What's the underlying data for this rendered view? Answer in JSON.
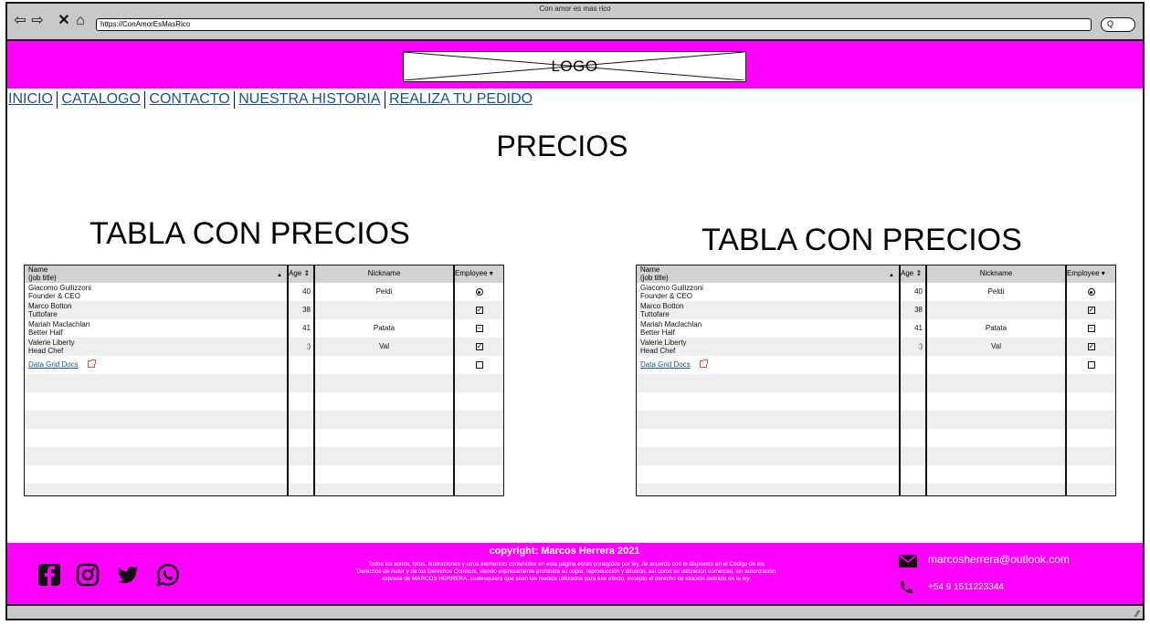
{
  "browser": {
    "window_title": "Con amor es mas rico",
    "url": "https://ConAmorEsMasRico",
    "search_glyph": "Q"
  },
  "header": {
    "logo_text": "LOGO"
  },
  "nav": {
    "items": [
      {
        "label": "INICIO"
      },
      {
        "label": "CATALOGO"
      },
      {
        "label": "CONTACTO"
      },
      {
        "label": "NUESTRA HISTORIA"
      },
      {
        "label": "REALIZA TU PEDIDO"
      }
    ]
  },
  "main": {
    "title": "PRECIOS",
    "tables": [
      {
        "title": "TABLA CON PRECIOS",
        "columns": {
          "name": "Name",
          "name_sub": "(job title)",
          "age": "Age",
          "nickname": "Nickname",
          "employee": "Employee"
        },
        "rows": [
          {
            "name": "Giacomo Guilizzoni",
            "title": "Founder & CEO",
            "age": "40",
            "nickname": "Peldi",
            "employee": "radio"
          },
          {
            "name": "Marco Botton",
            "title": "Tuttofare",
            "age": "38",
            "nickname": "",
            "employee": "checked"
          },
          {
            "name": "Mariah Maclachlan",
            "title": "Better Half",
            "age": "41",
            "nickname": "Patata",
            "employee": "mixed"
          },
          {
            "name": "Valerie Liberty",
            "title": "Head Chef",
            "age": ":)",
            "nickname": "Val",
            "employee": "checked"
          }
        ],
        "link": "Data Grid Docs",
        "link_employee": "unchecked"
      },
      {
        "title": "TABLA CON PRECIOS",
        "columns": {
          "name": "Name",
          "name_sub": "(job title)",
          "age": "Age",
          "nickname": "Nickname",
          "employee": "Employee"
        },
        "rows": [
          {
            "name": "Giacomo Guilizzoni",
            "title": "Founder & CEO",
            "age": "40",
            "nickname": "Peldi",
            "employee": "radio"
          },
          {
            "name": "Marco Botton",
            "title": "Tuttofare",
            "age": "38",
            "nickname": "",
            "employee": "checked"
          },
          {
            "name": "Mariah Maclachlan",
            "title": "Better Half",
            "age": "41",
            "nickname": "Patata",
            "employee": "mixed"
          },
          {
            "name": "Valerie Liberty",
            "title": "Head Chef",
            "age": ":)",
            "nickname": "Val",
            "employee": "checked"
          }
        ],
        "link": "Data Grid Docs",
        "link_employee": "unchecked"
      }
    ]
  },
  "footer": {
    "copyright": "copyright: Marcos Herrera 2021",
    "legal": "Todos los textos, fotos, ilustraciones y otros elementos contenidos en esta página están protegidos por ley, de acuerdo con lo dispuesto en el Código de los Derechos de Autor y de los Derechos Conexos, siendo expresamente prohibida su copia, reproducción y difusión, así como su utilización comercial, sin autorización expresa de MARCOS HERRERA, cualesquiera que sean los medios utilizados para ese efecto, excepto el derecho de citación definido en la ley.",
    "email": "marcosherrera@outlook.com",
    "phone": "+54 9 1511223344",
    "social": [
      "facebook-icon",
      "instagram-icon",
      "twitter-icon",
      "whatsapp-icon"
    ]
  },
  "colors": {
    "brand": "#ff00ff",
    "link": "#1e4f8a",
    "chrome": "#c9c9c9"
  }
}
